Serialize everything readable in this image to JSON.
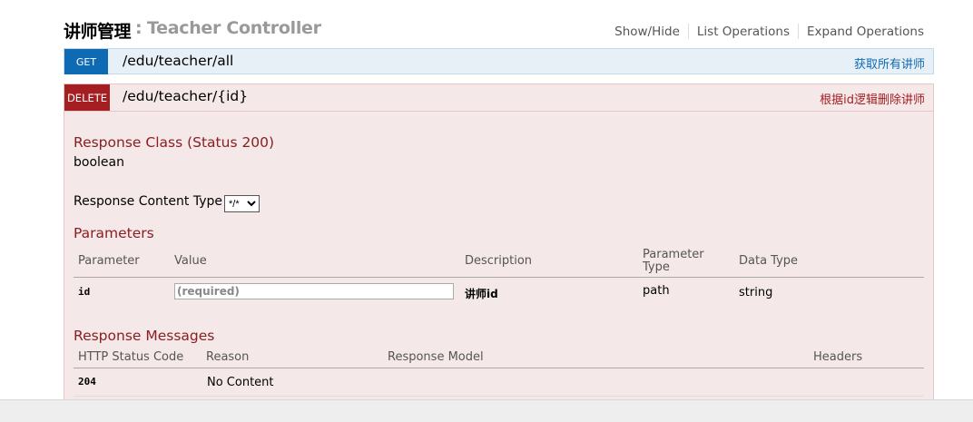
{
  "header": {
    "title_cn": "讲师管理",
    "separator": ":",
    "title_en": "Teacher Controller",
    "links": [
      "Show/Hide",
      "List Operations",
      "Expand Operations"
    ]
  },
  "operations": [
    {
      "method": "GET",
      "path": "/edu/teacher/all",
      "summary": "获取所有讲师",
      "color": "#0f6ab4"
    },
    {
      "method": "DELETE",
      "path": "/edu/teacher/{id}",
      "summary": "根据id逻辑删除讲师",
      "color": "#a41e22"
    }
  ],
  "delete_detail": {
    "response_class_title": "Response Class (Status 200)",
    "response_class_value": "boolean",
    "content_type_label": "Response Content Type",
    "content_type_value": "*/*",
    "parameters_title": "Parameters",
    "param_headers": {
      "parameter": "Parameter",
      "value": "Value",
      "description": "Description",
      "parameter_type_1": "Parameter",
      "parameter_type_2": "Type",
      "data_type": "Data Type"
    },
    "params": [
      {
        "name": "id",
        "placeholder": "(required)",
        "description": "讲师id",
        "param_type": "path",
        "data_type": "string"
      }
    ],
    "response_messages_title": "Response Messages",
    "resp_headers": {
      "code": "HTTP Status Code",
      "reason": "Reason",
      "model": "Response Model",
      "headers": "Headers"
    },
    "responses": [
      {
        "code": "204",
        "reason": "No Content"
      }
    ]
  }
}
